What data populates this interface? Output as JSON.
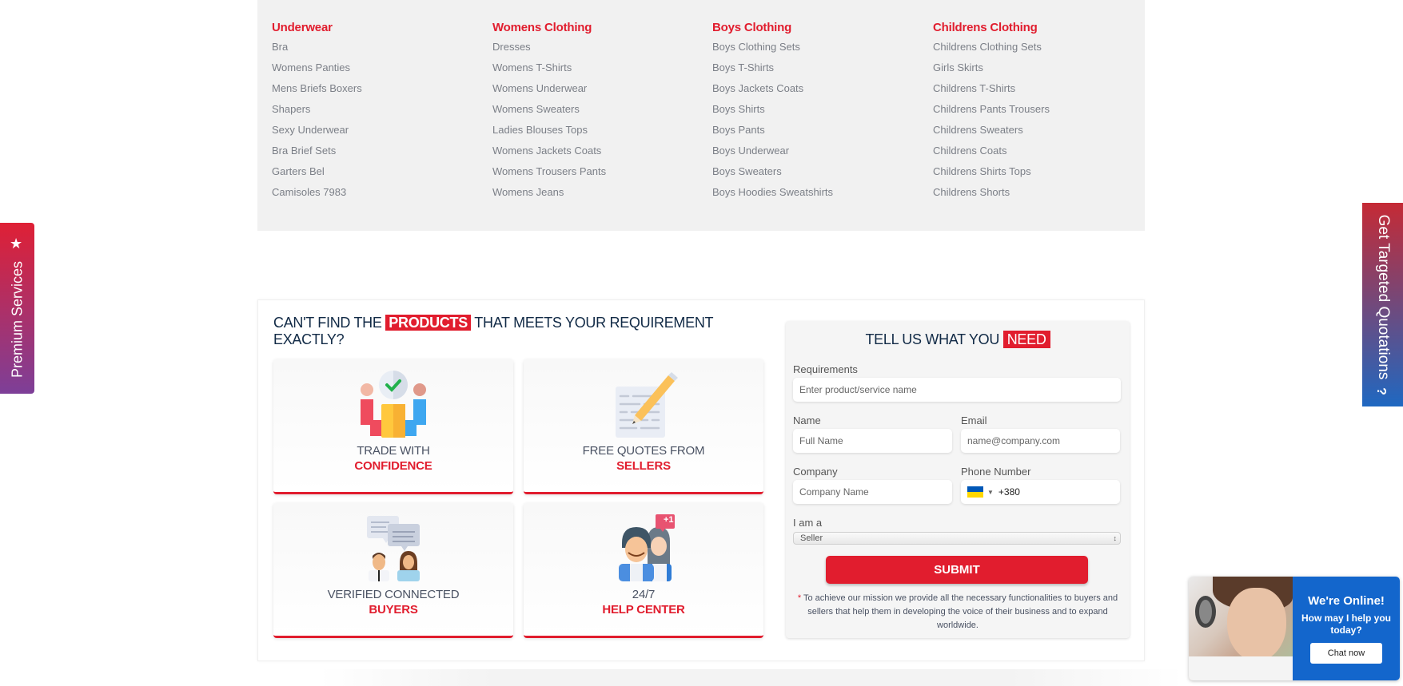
{
  "categories": [
    {
      "title": "Underwear",
      "links": [
        "Bra",
        "Womens Panties",
        "Mens Briefs Boxers",
        "Shapers",
        "Sexy Underwear",
        "Bra Brief Sets",
        "Garters Bel",
        "Camisoles 7983"
      ]
    },
    {
      "title": "Womens Clothing",
      "links": [
        "Dresses",
        "Womens T-Shirts",
        "Womens Underwear",
        "Womens Sweaters",
        "Ladies Blouses Tops",
        "Womens Jackets Coats",
        "Womens Trousers Pants",
        "Womens Jeans"
      ]
    },
    {
      "title": "Boys Clothing",
      "links": [
        "Boys Clothing Sets",
        "Boys T-Shirts",
        "Boys Jackets Coats",
        "Boys Shirts",
        "Boys Pants",
        "Boys Underwear",
        "Boys Sweaters",
        "Boys Hoodies Sweatshirts"
      ]
    },
    {
      "title": "Childrens Clothing",
      "links": [
        "Childrens Clothing Sets",
        "Girls Skirts",
        "Childrens T-Shirts",
        "Childrens Pants Trousers",
        "Childrens Sweaters",
        "Childrens Coats",
        "Childrens Shirts Tops",
        "Childrens Shorts"
      ]
    }
  ],
  "headline": {
    "before": "CAN'T FIND THE",
    "highlight": "PRODUCTS",
    "after": "THAT MEETS YOUR REQUIREMENT EXACTLY?"
  },
  "features": [
    {
      "icon": "handshake-trade-icon",
      "line1": "TRADE WITH",
      "line2": "CONFIDENCE"
    },
    {
      "icon": "quote-document-pencil-icon",
      "line1": "FREE QUOTES FROM",
      "line2": "SELLERS"
    },
    {
      "icon": "verified-buyers-chat-icon",
      "line1": "VERIFIED CONNECTED",
      "line2": "BUYERS"
    },
    {
      "icon": "help-center-people-icon",
      "line1": "24/7",
      "line2": "HELP CENTER",
      "badge": "+1"
    }
  ],
  "form": {
    "title_before": "TELL US WHAT YOU",
    "title_highlight": "NEED",
    "requirements_label": "Requirements",
    "requirements_placeholder": "Enter product/service name",
    "name_label": "Name",
    "name_placeholder": "Full Name",
    "email_label": "Email",
    "email_placeholder": "name@company.com",
    "company_label": "Company",
    "company_placeholder": "Company Name",
    "phone_label": "Phone Number",
    "phone_country_flag": "ukraine-flag-icon",
    "phone_value": "+380",
    "role_label": "I am a",
    "role_selected": "Seller",
    "submit_label": "SUBMIT",
    "disclaimer_star": "*",
    "disclaimer": "To achieve our mission we provide all the necessary functionalities to buyers and sellers that help them in developing the voice of their business and to expand worldwide."
  },
  "side_tabs": {
    "premium": "Premium Services",
    "quotations": "Get Targeted Quotations",
    "quotations_icon": "?"
  },
  "chat": {
    "title": "We're Online!",
    "subtitle": "How may I help you today?",
    "button": "Chat now"
  },
  "colors": {
    "accent_red": "#e11d2e",
    "navy": "#112a46",
    "chat_blue": "#1366cc"
  }
}
